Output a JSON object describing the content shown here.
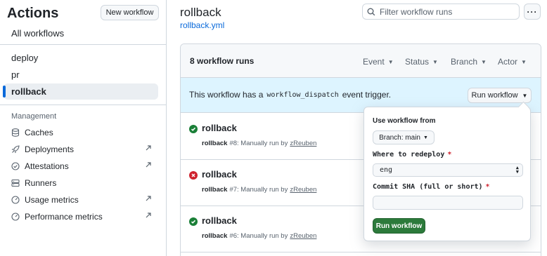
{
  "sidebar": {
    "title": "Actions",
    "new_workflow_label": "New workflow",
    "all_workflows_label": "All workflows",
    "workflows": [
      {
        "label": "deploy"
      },
      {
        "label": "pr"
      },
      {
        "label": "rollback"
      }
    ],
    "management_heading": "Management",
    "management_items": [
      {
        "label": "Caches",
        "icon": "database-icon",
        "external": false
      },
      {
        "label": "Deployments",
        "icon": "rocket-icon",
        "external": true
      },
      {
        "label": "Attestations",
        "icon": "check-circle-icon",
        "external": true
      },
      {
        "label": "Runners",
        "icon": "server-icon",
        "external": false
      },
      {
        "label": "Usage metrics",
        "icon": "meter-icon",
        "external": true
      },
      {
        "label": "Performance metrics",
        "icon": "meter-icon",
        "external": true
      }
    ]
  },
  "header": {
    "title": "rollback",
    "file_link": "rollback.yml",
    "search_placeholder": "Filter workflow runs",
    "more_label": "···"
  },
  "runs_panel": {
    "count_label": "8 workflow runs",
    "filters": [
      {
        "label": "Event"
      },
      {
        "label": "Status"
      },
      {
        "label": "Branch"
      },
      {
        "label": "Actor"
      }
    ],
    "banner": {
      "text_before": "This workflow has a",
      "code": "workflow_dispatch",
      "text_after": "event trigger.",
      "button_label": "Run workflow"
    },
    "runs": [
      {
        "name": "rollback",
        "status": "success",
        "workflow": "rollback",
        "meta": "#8: Manually run by",
        "actor": "zReuben"
      },
      {
        "name": "rollback",
        "status": "failure",
        "workflow": "rollback",
        "meta": "#7: Manually run by",
        "actor": "zReuben"
      },
      {
        "name": "rollback",
        "status": "success",
        "workflow": "rollback",
        "meta": "#6: Manually run by",
        "actor": "zReuben"
      }
    ]
  },
  "dispatch_form": {
    "use_from_label": "Use workflow from",
    "branch_button": "Branch: main",
    "field1_label": "Where to redeploy",
    "field1_required": "*",
    "field1_value": "eng",
    "field2_label": "Commit SHA (full or short)",
    "field2_required": "*",
    "field2_value": "",
    "submit_label": "Run workflow"
  },
  "colors": {
    "accent": "#0969da",
    "success": "#1a7f37",
    "failure": "#cf222e",
    "banner_bg": "#ddf4ff",
    "primary_button": "#2c7a3b"
  }
}
